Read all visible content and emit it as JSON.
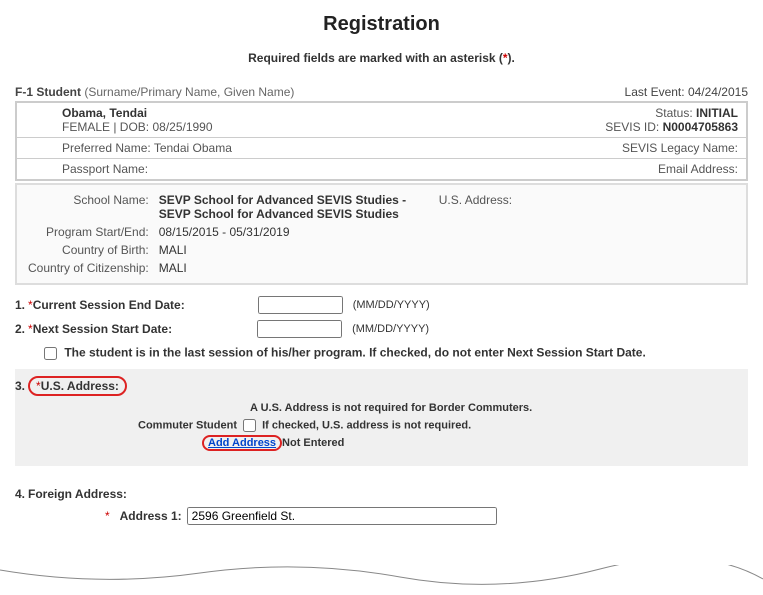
{
  "title": "Registration",
  "required_note_pre": "Required fields are marked with an asterisk (",
  "required_note_post": ").",
  "visa_type": "F-1 Student",
  "visa_sub": "(Surname/Primary Name, Given Name)",
  "last_event_label": "Last Event:",
  "last_event_date": "04/24/2015",
  "student": {
    "name": "Obama, Tendai",
    "gender_dob": "FEMALE | DOB: 08/25/1990",
    "status_label": "Status:",
    "status": "INITIAL",
    "sevis_id_label": "SEVIS ID:",
    "sevis_id": "N0004705863",
    "pref_name_label": "Preferred Name:",
    "pref_name": "Tendai Obama",
    "legacy_label": "SEVIS Legacy Name:",
    "passport_label": "Passport Name:",
    "email_label": "Email Address:"
  },
  "school": {
    "school_label": "School Name:",
    "school_name": "SEVP School for Advanced SEVIS Studies - SEVP School for Advanced SEVIS Studies",
    "us_addr_label": "U.S. Address:",
    "program_label": "Program Start/End:",
    "program_dates": "08/15/2015  - 05/31/2019",
    "cob_label": "Country of Birth:",
    "cob": "MALI",
    "coc_label": "Country of Citizenship:",
    "coc": "MALI"
  },
  "form": {
    "q1_num": "1.",
    "q1_label": "Current Session End Date:",
    "q2_num": "2.",
    "q2_label": "Next Session Start Date:",
    "date_fmt": "(MM/DD/YYYY)",
    "last_session_text": "The student is in the last session of his/her program. If checked, do not enter Next Session Start Date.",
    "q3_num": "3.",
    "q3_label": "U.S. Address:",
    "border_note": "A U.S. Address is not required for Border Commuters.",
    "commuter_label": "Commuter Student",
    "commuter_note": "If checked, U.S. address is not required.",
    "add_address": "Add Address",
    "not_entered": "Not Entered",
    "q4_num": "4.",
    "q4_label": "Foreign Address:",
    "addr1_label": "Address 1:",
    "addr1_value": "2596 Greenfield St."
  }
}
